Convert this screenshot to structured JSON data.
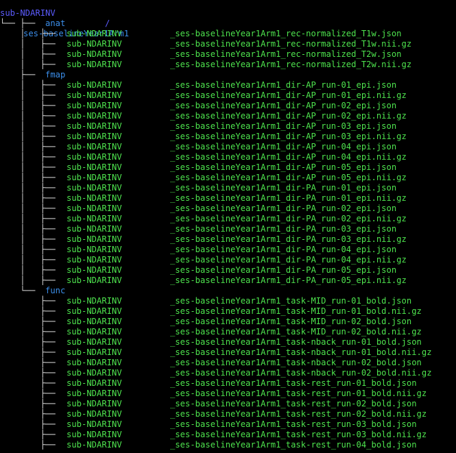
{
  "colors": {
    "background": "#000000",
    "directory": "#5c5cff",
    "file": "#4ee44e",
    "tree_lines": "#d8d8d8"
  },
  "root": {
    "name": "sub-NDARINV",
    "slash": "/"
  },
  "session": {
    "connector": "└── ",
    "name": "ses-baselineYear1Arm1"
  },
  "folders": [
    {
      "connector": "    ├── ",
      "name": "anat",
      "files": [
        {
          "prefix": "sub-NDARINV",
          "suffix": "_ses-baselineYear1Arm1_rec-normalized_T1w.json"
        },
        {
          "prefix": "sub-NDARINV",
          "suffix": "_ses-baselineYear1Arm1_rec-normalized_T1w.nii.gz"
        },
        {
          "prefix": "sub-NDARINV",
          "suffix": "_ses-baselineYear1Arm1_rec-normalized_T2w.json"
        },
        {
          "prefix": "sub-NDARINV",
          "suffix": "_ses-baselineYear1Arm1_rec-normalized_T2w.nii.gz"
        }
      ]
    },
    {
      "connector": "    ├── ",
      "name": "fmap",
      "files": [
        {
          "prefix": "sub-NDARINV",
          "suffix": "_ses-baselineYear1Arm1_dir-AP_run-01_epi.json"
        },
        {
          "prefix": "sub-NDARINV",
          "suffix": "_ses-baselineYear1Arm1_dir-AP_run-01_epi.nii.gz"
        },
        {
          "prefix": "sub-NDARINV",
          "suffix": "_ses-baselineYear1Arm1_dir-AP_run-02_epi.json"
        },
        {
          "prefix": "sub-NDARINV",
          "suffix": "_ses-baselineYear1Arm1_dir-AP_run-02_epi.nii.gz"
        },
        {
          "prefix": "sub-NDARINV",
          "suffix": "_ses-baselineYear1Arm1_dir-AP_run-03_epi.json"
        },
        {
          "prefix": "sub-NDARINV",
          "suffix": "_ses-baselineYear1Arm1_dir-AP_run-03_epi.nii.gz"
        },
        {
          "prefix": "sub-NDARINV",
          "suffix": "_ses-baselineYear1Arm1_dir-AP_run-04_epi.json"
        },
        {
          "prefix": "sub-NDARINV",
          "suffix": "_ses-baselineYear1Arm1_dir-AP_run-04_epi.nii.gz"
        },
        {
          "prefix": "sub-NDARINV",
          "suffix": "_ses-baselineYear1Arm1_dir-AP_run-05_epi.json"
        },
        {
          "prefix": "sub-NDARINV",
          "suffix": "_ses-baselineYear1Arm1_dir-AP_run-05_epi.nii.gz"
        },
        {
          "prefix": "sub-NDARINV",
          "suffix": "_ses-baselineYear1Arm1_dir-PA_run-01_epi.json"
        },
        {
          "prefix": "sub-NDARINV",
          "suffix": "_ses-baselineYear1Arm1_dir-PA_run-01_epi.nii.gz"
        },
        {
          "prefix": "sub-NDARINV",
          "suffix": "_ses-baselineYear1Arm1_dir-PA_run-02_epi.json"
        },
        {
          "prefix": "sub-NDARINV",
          "suffix": "_ses-baselineYear1Arm1_dir-PA_run-02_epi.nii.gz"
        },
        {
          "prefix": "sub-NDARINV",
          "suffix": "_ses-baselineYear1Arm1_dir-PA_run-03_epi.json"
        },
        {
          "prefix": "sub-NDARINV",
          "suffix": "_ses-baselineYear1Arm1_dir-PA_run-03_epi.nii.gz"
        },
        {
          "prefix": "sub-NDARINV",
          "suffix": "_ses-baselineYear1Arm1_dir-PA_run-04_epi.json"
        },
        {
          "prefix": "sub-NDARINV",
          "suffix": "_ses-baselineYear1Arm1_dir-PA_run-04_epi.nii.gz"
        },
        {
          "prefix": "sub-NDARINV",
          "suffix": "_ses-baselineYear1Arm1_dir-PA_run-05_epi.json"
        },
        {
          "prefix": "sub-NDARINV",
          "suffix": "_ses-baselineYear1Arm1_dir-PA_run-05_epi.nii.gz"
        }
      ]
    },
    {
      "connector": "    └── ",
      "name": "func",
      "files": [
        {
          "prefix": "sub-NDARINV",
          "suffix": "_ses-baselineYear1Arm1_task-MID_run-01_bold.json"
        },
        {
          "prefix": "sub-NDARINV",
          "suffix": "_ses-baselineYear1Arm1_task-MID_run-01_bold.nii.gz"
        },
        {
          "prefix": "sub-NDARINV",
          "suffix": "_ses-baselineYear1Arm1_task-MID_run-02_bold.json"
        },
        {
          "prefix": "sub-NDARINV",
          "suffix": "_ses-baselineYear1Arm1_task-MID_run-02_bold.nii.gz"
        },
        {
          "prefix": "sub-NDARINV",
          "suffix": "_ses-baselineYear1Arm1_task-nback_run-01_bold.json"
        },
        {
          "prefix": "sub-NDARINV",
          "suffix": "_ses-baselineYear1Arm1_task-nback_run-01_bold.nii.gz"
        },
        {
          "prefix": "sub-NDARINV",
          "suffix": "_ses-baselineYear1Arm1_task-nback_run-02_bold.json"
        },
        {
          "prefix": "sub-NDARINV",
          "suffix": "_ses-baselineYear1Arm1_task-nback_run-02_bold.nii.gz"
        },
        {
          "prefix": "sub-NDARINV",
          "suffix": "_ses-baselineYear1Arm1_task-rest_run-01_bold.json"
        },
        {
          "prefix": "sub-NDARINV",
          "suffix": "_ses-baselineYear1Arm1_task-rest_run-01_bold.nii.gz"
        },
        {
          "prefix": "sub-NDARINV",
          "suffix": "_ses-baselineYear1Arm1_task-rest_run-02_bold.json"
        },
        {
          "prefix": "sub-NDARINV",
          "suffix": "_ses-baselineYear1Arm1_task-rest_run-02_bold.nii.gz"
        },
        {
          "prefix": "sub-NDARINV",
          "suffix": "_ses-baselineYear1Arm1_task-rest_run-03_bold.json"
        },
        {
          "prefix": "sub-NDARINV",
          "suffix": "_ses-baselineYear1Arm1_task-rest_run-03_bold.nii.gz"
        },
        {
          "prefix": "sub-NDARINV",
          "suffix": "_ses-baselineYear1Arm1_task-rest_run-04_bold.json"
        }
      ]
    }
  ]
}
